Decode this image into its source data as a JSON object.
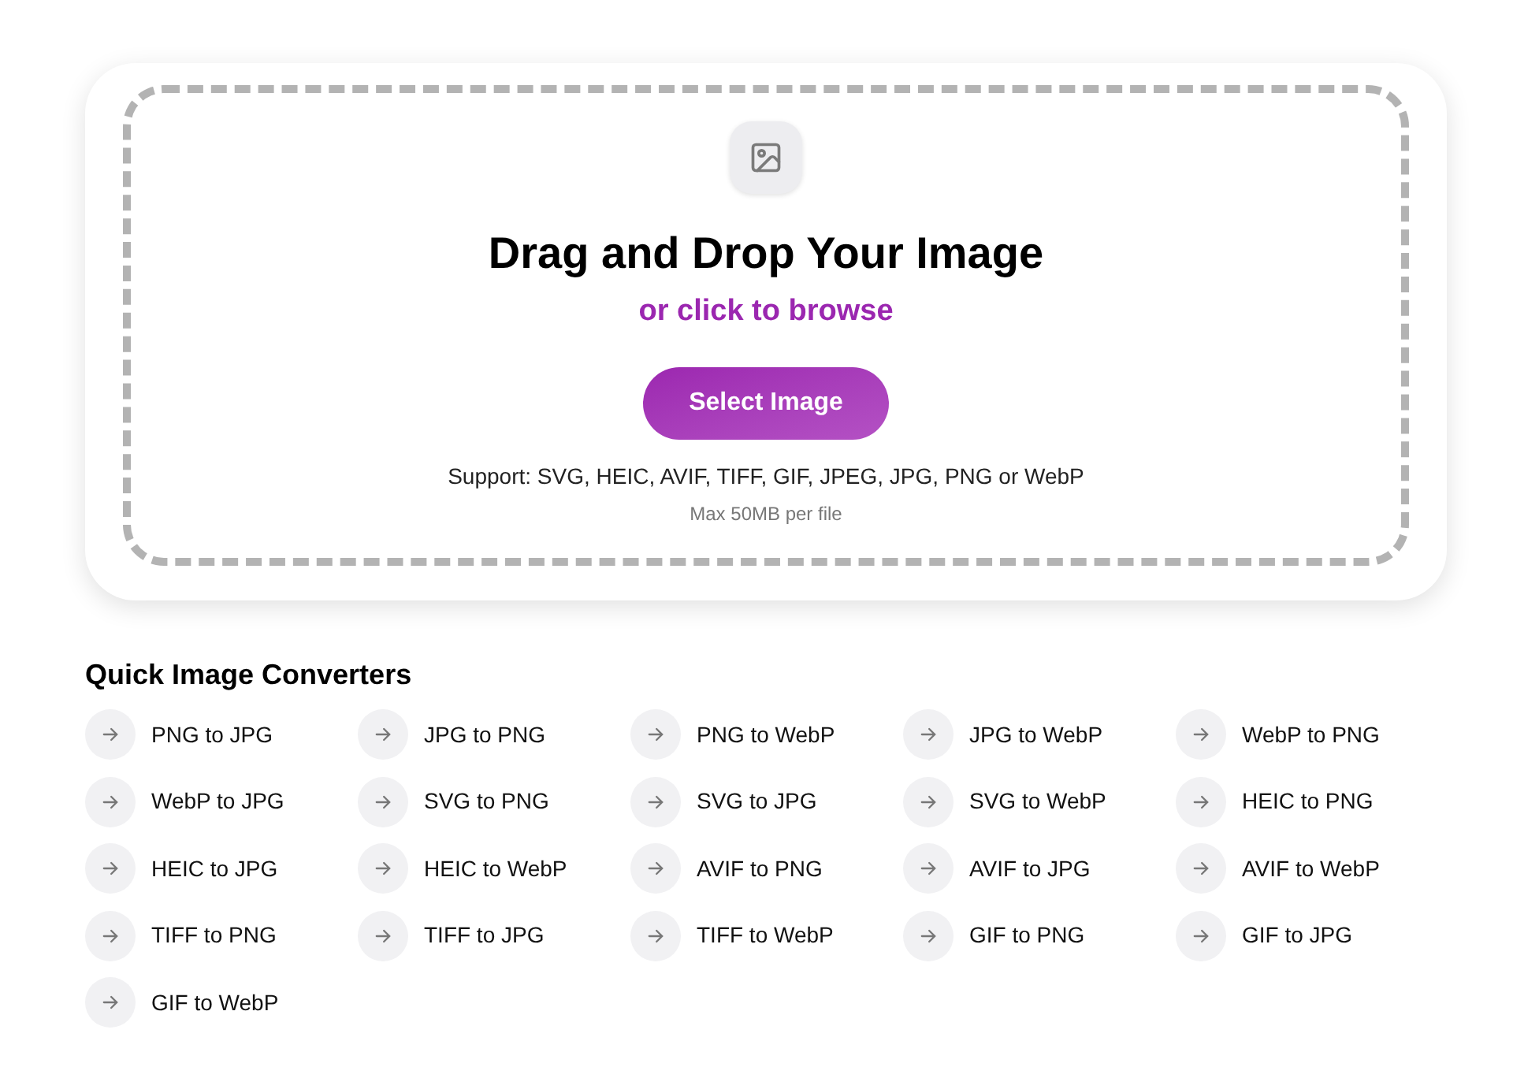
{
  "upload": {
    "title": "Drag and Drop Your Image",
    "browse_link": "or click to browse",
    "button": "Select Image",
    "support": "Support: SVG, HEIC, AVIF, TIFF, GIF, JPEG, JPG, PNG or WebP",
    "limit": "Max 50MB per file"
  },
  "converters": {
    "title": "Quick Image Converters",
    "items": [
      "PNG to JPG",
      "JPG to PNG",
      "PNG to WebP",
      "JPG to WebP",
      "WebP to PNG",
      "WebP to JPG",
      "SVG to PNG",
      "SVG to JPG",
      "SVG to WebP",
      "HEIC to PNG",
      "HEIC to JPG",
      "HEIC to WebP",
      "AVIF to PNG",
      "AVIF to JPG",
      "AVIF to WebP",
      "TIFF to PNG",
      "TIFF to JPG",
      "TIFF to WebP",
      "GIF to PNG",
      "GIF to JPG",
      "GIF to WebP"
    ]
  }
}
